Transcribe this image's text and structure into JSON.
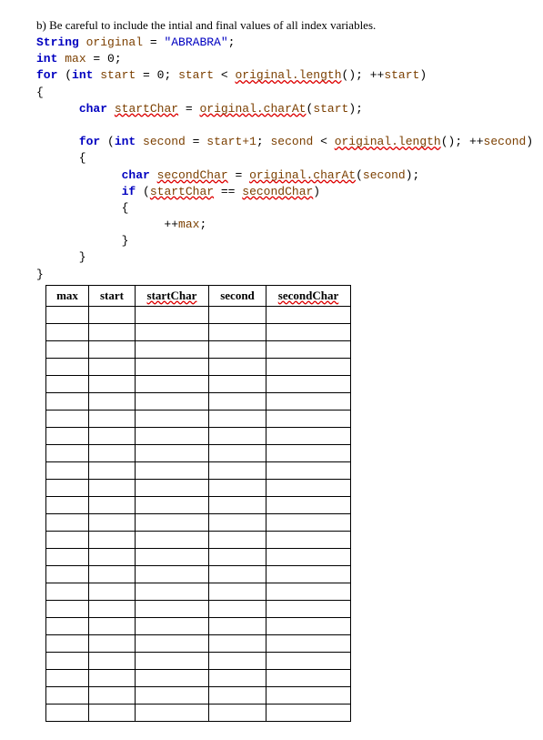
{
  "question": {
    "prefix": "b) Be careful to include the ",
    "word1": "intial",
    "mid": " and final values of all index variables.",
    "full_plain": "b) Be careful to include the intial and final values of all index variables."
  },
  "code": {
    "t_String": "String",
    "v_original": "original",
    "eq": "=",
    "s_lit": "\"ABRABRA\"",
    "semi": ";",
    "t_int": "int",
    "v_max": "max",
    "n_zero": "0",
    "k_for": "for",
    "lp": "(",
    "rp": ")",
    "v_start": "start",
    "lt": "<",
    "m_length": "original.length",
    "inc": "++start",
    "lb": "{",
    "rb": "}",
    "t_char": "char",
    "v_startChar": "startChar",
    "m_charAt": "original.charAt",
    "arg_start": "(start);",
    "v_second": "second",
    "expr_start1": "start+1",
    "m_length2": "original.length",
    "inc2": "++second",
    "v_secondChar": "secondChar",
    "m_charAt2": "original.charAt",
    "arg_second": "(second);",
    "k_if": "if",
    "cmp": "==",
    "v_startChar2": "startChar",
    "v_secondChar2": "secondChar",
    "stmt_inc": "++max;"
  },
  "table": {
    "headers": {
      "c1": "max",
      "c2": "start",
      "c3": "startChar",
      "c4": "second",
      "c5": "secondChar"
    },
    "rows": 24
  }
}
